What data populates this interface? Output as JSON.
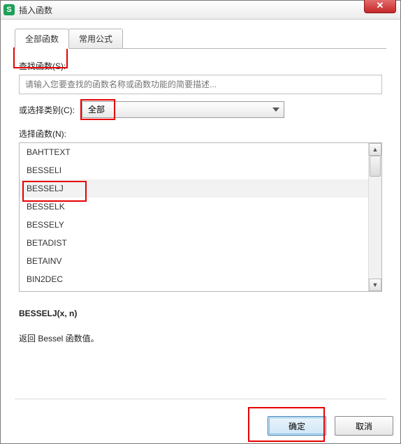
{
  "window": {
    "title": "插入函数",
    "app_icon_letter": "S"
  },
  "tabs": {
    "all_functions": "全部函数",
    "common_formulas": "常用公式"
  },
  "search": {
    "label": "查找函数(S):",
    "placeholder": "请输入您要查找的函数名称或函数功能的简要描述..."
  },
  "category": {
    "label": "或选择类别(C):",
    "selected": "全部"
  },
  "function_list": {
    "label": "选择函数(N):",
    "items": [
      "BAHTTEXT",
      "BESSELI",
      "BESSELJ",
      "BESSELK",
      "BESSELY",
      "BETADIST",
      "BETAINV",
      "BIN2DEC"
    ],
    "selected_index": 2
  },
  "details": {
    "syntax": "BESSELJ(x, n)",
    "description": "返回 Bessel 函数值。"
  },
  "buttons": {
    "ok": "确定",
    "cancel": "取消"
  },
  "close_glyph": "✕",
  "scroll_up_glyph": "▲",
  "scroll_down_glyph": "▼"
}
